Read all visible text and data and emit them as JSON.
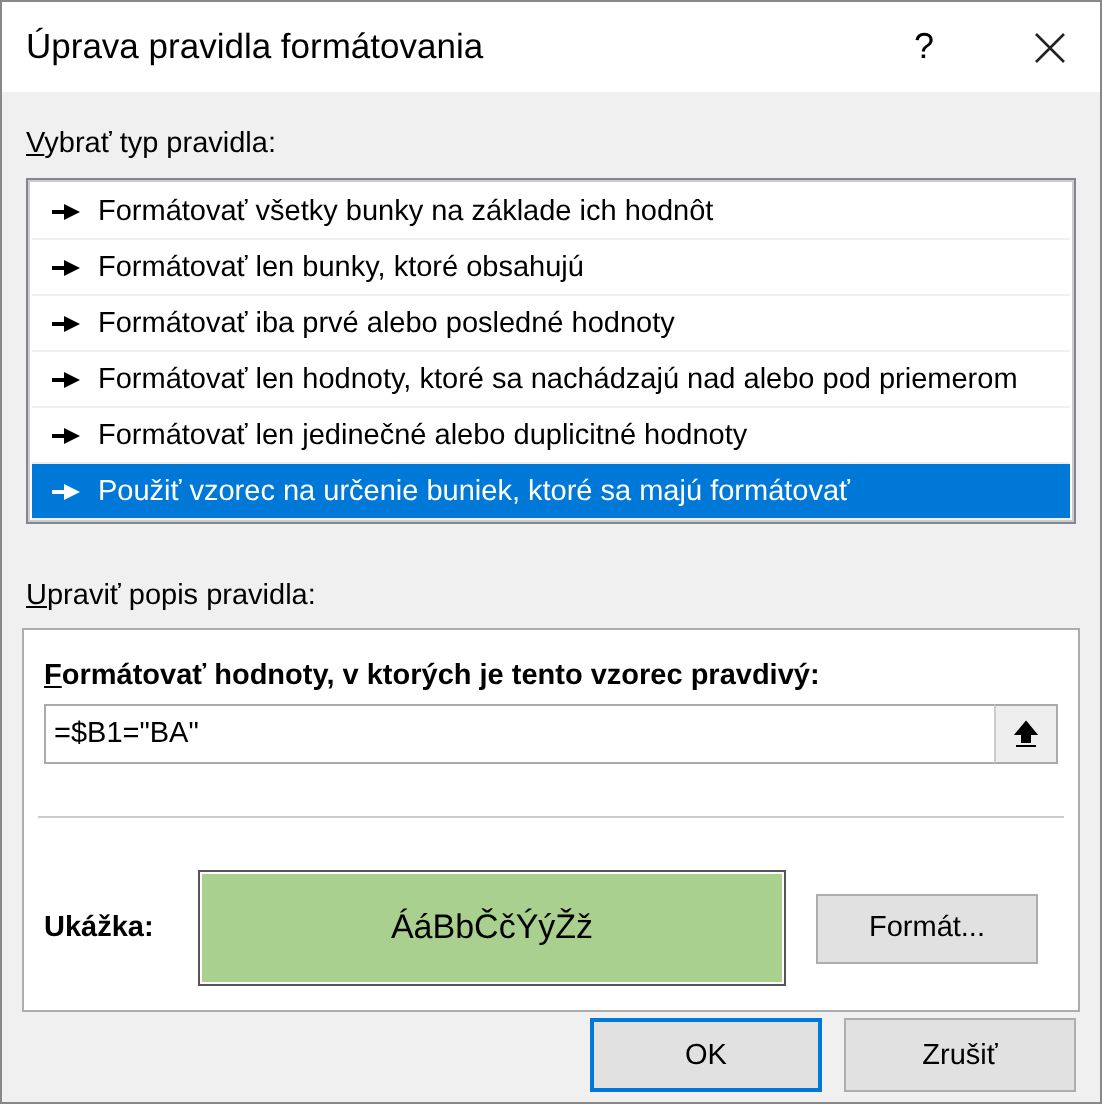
{
  "window": {
    "title": "Úprava pravidla formátovania",
    "help": "?"
  },
  "rule_type": {
    "label": "Vybrať typ pravidla:",
    "items": [
      {
        "label": "Formátovať všetky bunky na základe ich hodnôt",
        "selected": false
      },
      {
        "label": "Formátovať len bunky, ktoré obsahujú",
        "selected": false
      },
      {
        "label": "Formátovať iba prvé alebo posledné hodnoty",
        "selected": false
      },
      {
        "label": "Formátovať len hodnoty, ktoré sa nachádzajú nad alebo pod priemerom",
        "selected": false
      },
      {
        "label": "Formátovať len jedinečné alebo duplicitné hodnoty",
        "selected": false
      },
      {
        "label": "Použiť vzorec na určenie buniek, ktoré sa majú formátovať",
        "selected": true
      }
    ]
  },
  "description": {
    "label": "Upraviť popis pravidla:",
    "formula_label": "Formátovať hodnoty, v ktorých je tento vzorec pravdivý:",
    "formula": "=$B1=\"BA\"",
    "preview_label": "Ukážka:",
    "preview_text": "ÁáBbČčÝýŽž",
    "format_button": "Formát..."
  },
  "buttons": [
    {
      "label": "OK",
      "default": true
    },
    {
      "label": "Zrušiť",
      "default": false
    }
  ]
}
